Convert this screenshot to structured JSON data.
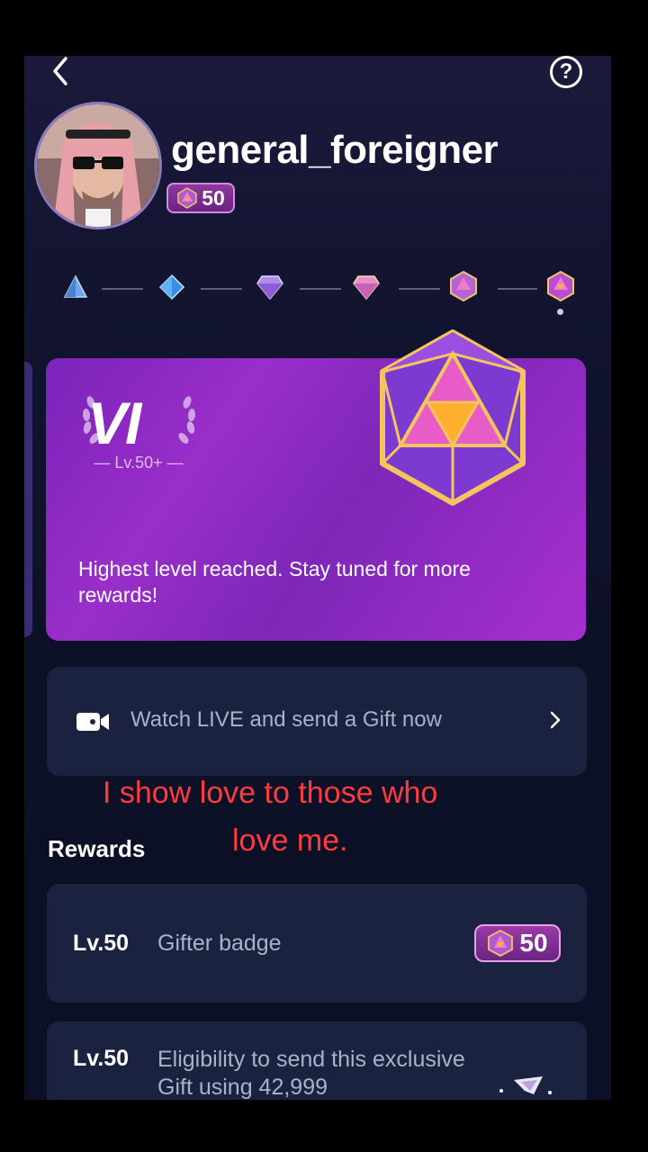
{
  "header": {
    "back_icon": "chevron-left-icon",
    "help_label": "?"
  },
  "profile": {
    "username": "general_foreigner",
    "gifter_level": "50"
  },
  "progression": {
    "tiers": [
      "I",
      "II",
      "III",
      "IV",
      "V",
      "VI"
    ],
    "current_tier_index": 5
  },
  "tier_card": {
    "roman": "VI",
    "level_text": "— Lv.50+ —",
    "message": "Highest level reached. Stay tuned for more rewards!"
  },
  "live_prompt": {
    "icon": "video-camera-icon",
    "label": "Watch LIVE and send a Gift now"
  },
  "overlay_caption": {
    "line1": "I show love to those who",
    "line2": "love me."
  },
  "rewards": {
    "title": "Rewards",
    "items": [
      {
        "level": "Lv.50",
        "label": "Gifter badge",
        "badge_value": "50"
      },
      {
        "level": "Lv.50",
        "label": "Eligibility to send this exclusive Gift using 42,999"
      }
    ]
  },
  "colors": {
    "background": "#0d1128",
    "card_purple": "#8a2bc2",
    "row_bg": "#1a2240",
    "overlay_text": "#ff3b3b",
    "muted_text": "#aab2c8"
  }
}
